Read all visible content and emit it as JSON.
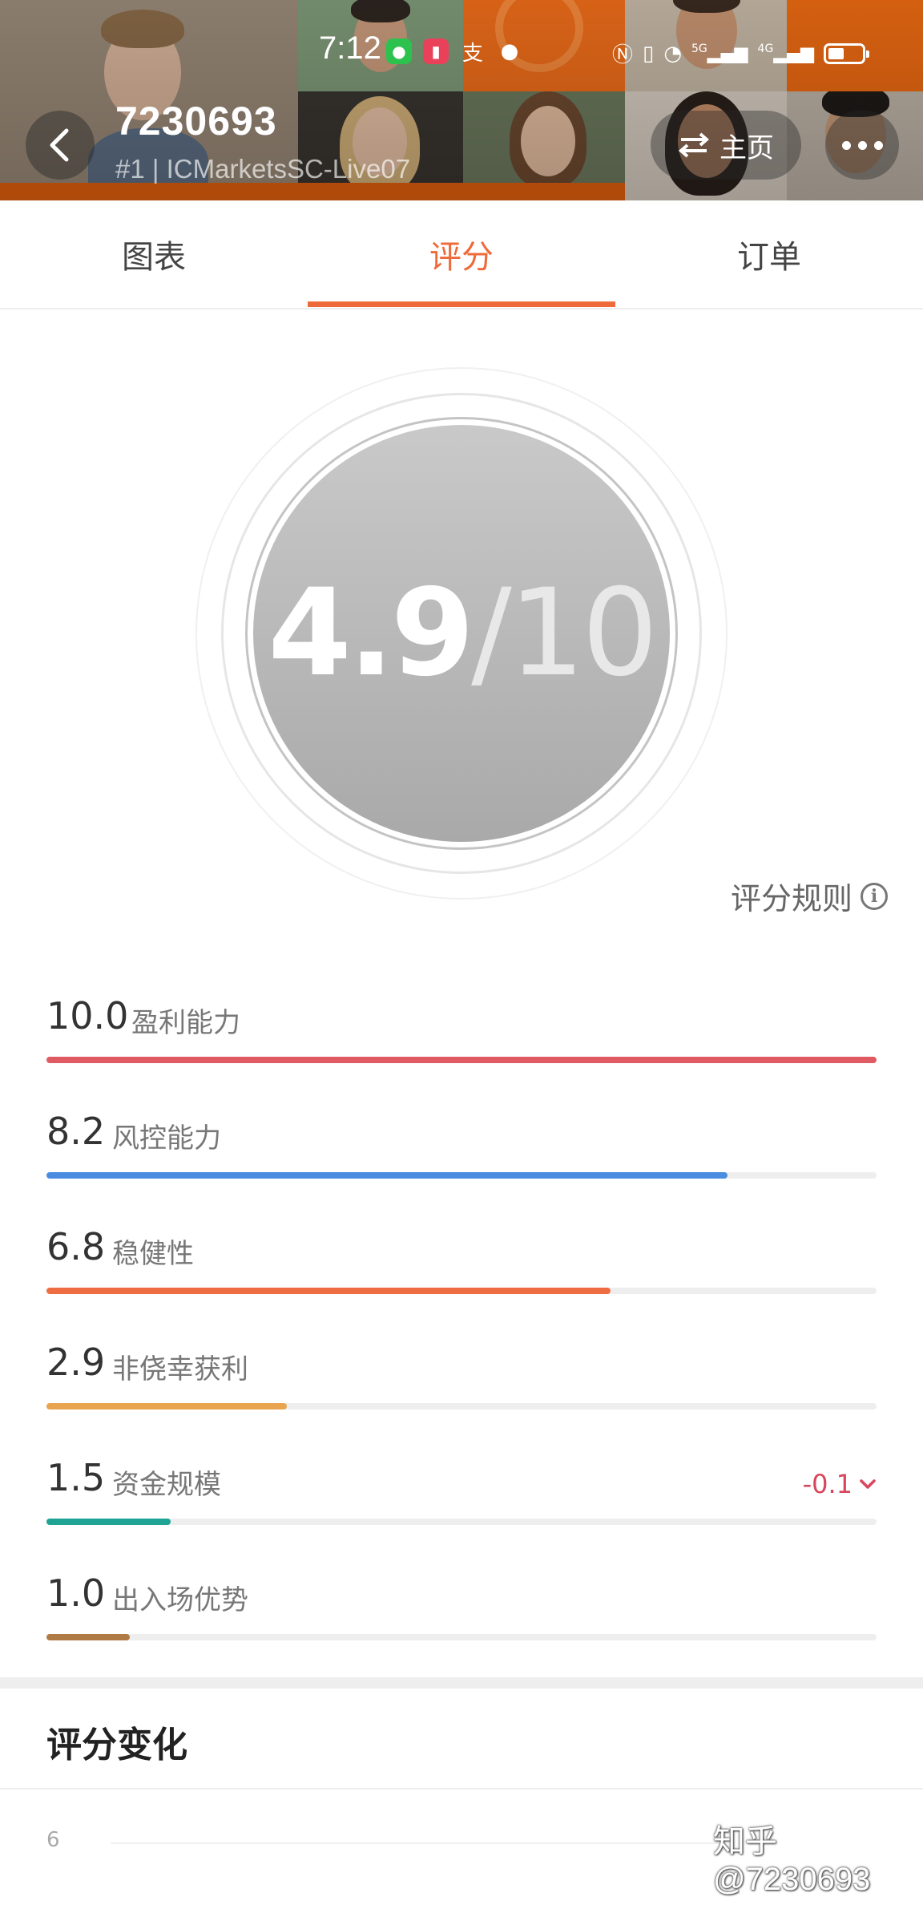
{
  "status_bar": {
    "time": "7:12",
    "network": "5G",
    "network2": "4G",
    "battery_level": 0.55
  },
  "header": {
    "account_id": "7230693",
    "account_subtitle": "#1 | ICMarketsSC-Live07",
    "home_label": "主页"
  },
  "tabs": [
    {
      "label": "图表",
      "active": false
    },
    {
      "label": "评分",
      "active": true
    },
    {
      "label": "订单",
      "active": false
    }
  ],
  "score": {
    "value": "4.9",
    "separator": "/",
    "total": "10"
  },
  "rules_link": {
    "label": "评分规则"
  },
  "metrics": [
    {
      "value": "10.0",
      "label": "盈利能力",
      "level": 1.0,
      "color": "#e05a64"
    },
    {
      "value": "8.2",
      "label": "风控能力",
      "level": 0.82,
      "color": "#4a8de0"
    },
    {
      "value": "6.8",
      "label": "稳健性",
      "level": 0.68,
      "color": "#ef6d42"
    },
    {
      "value": "2.9",
      "label": "非侥幸获利",
      "level": 0.29,
      "color": "#e8a44f"
    },
    {
      "value": "1.5",
      "label": "资金规模",
      "level": 0.15,
      "color": "#1fa394",
      "delta": "-0.1"
    },
    {
      "value": "1.0",
      "label": "出入场优势",
      "level": 0.1,
      "color": "#b07a45"
    }
  ],
  "score_change": {
    "title": "评分变化",
    "axis_top": "6"
  },
  "watermark": "知乎 @7230693"
}
